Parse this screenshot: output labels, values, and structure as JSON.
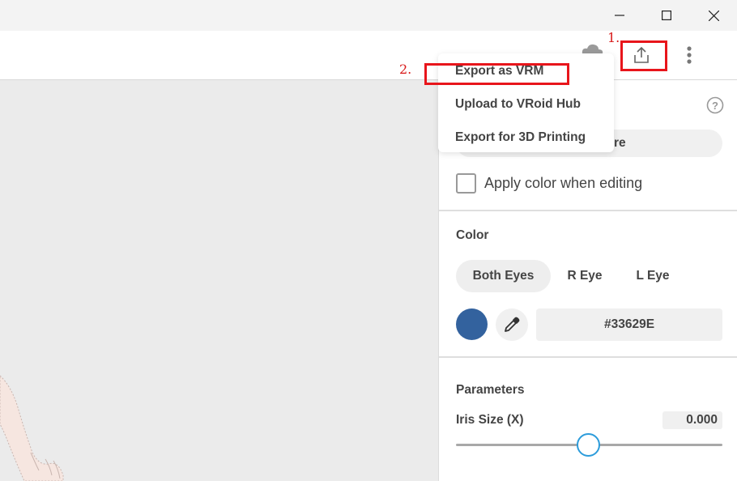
{
  "titlebar": {
    "minimize_icon": "minimize-icon",
    "maximize_icon": "maximize-icon",
    "close_icon": "close-icon"
  },
  "toolbar": {
    "cloud_icon": "cloud-icon",
    "export_icon": "export-upload-icon",
    "more_icon": "more-vertical-icon"
  },
  "annotations": {
    "step1": "1.",
    "step2": "2.",
    "highlight_color": "#e8151b"
  },
  "export_menu": {
    "items": [
      {
        "label": "Export as VRM"
      },
      {
        "label": "Upload to VRoid Hub"
      },
      {
        "label": "Export for 3D Printing"
      }
    ]
  },
  "panel": {
    "help_icon": "help-icon",
    "hidden_button_fragment": "re",
    "apply_color_label": "Apply color when editing",
    "apply_color_checked": false,
    "color": {
      "heading": "Color",
      "tabs": [
        {
          "label": "Both Eyes",
          "active": true
        },
        {
          "label": "R Eye",
          "active": false
        },
        {
          "label": "L Eye",
          "active": false
        }
      ],
      "swatch_color": "#33629E",
      "hex_value": "#33629E",
      "eyedropper_icon": "eyedropper-icon"
    },
    "parameters": {
      "heading": "Parameters",
      "iris_size_x_label": "Iris Size (X)",
      "iris_size_x_value": "0.000",
      "accent_color": "#2d9cdb"
    }
  }
}
